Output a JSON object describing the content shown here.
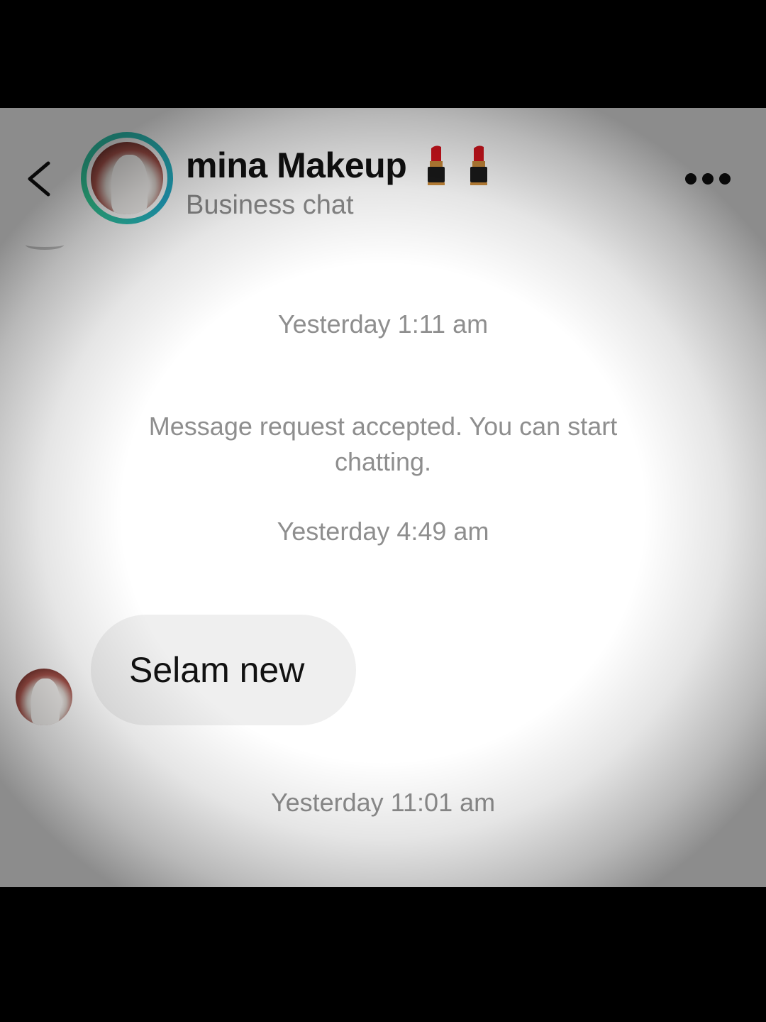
{
  "header": {
    "name": "mina Makeup",
    "name_emojis": [
      "lipstick-icon",
      "lipstick-icon"
    ],
    "subtitle": "Business chat",
    "back_icon": "chevron-left-icon",
    "more_icon": "more-horizontal-icon",
    "avatar_ring_color": "#2ec4b6"
  },
  "conversation": {
    "timestamp_1": "Yesterday 1:11 am",
    "system_message": "Message request accepted. You can start chatting.",
    "timestamp_2": "Yesterday 4:49 am",
    "incoming_message": "Selam new",
    "timestamp_3": "Yesterday 11:01 am"
  },
  "colors": {
    "bubble_background": "#efefef",
    "muted_text": "#8e8e8e",
    "primary_text": "#111111",
    "lipstick": "#d7141e"
  }
}
